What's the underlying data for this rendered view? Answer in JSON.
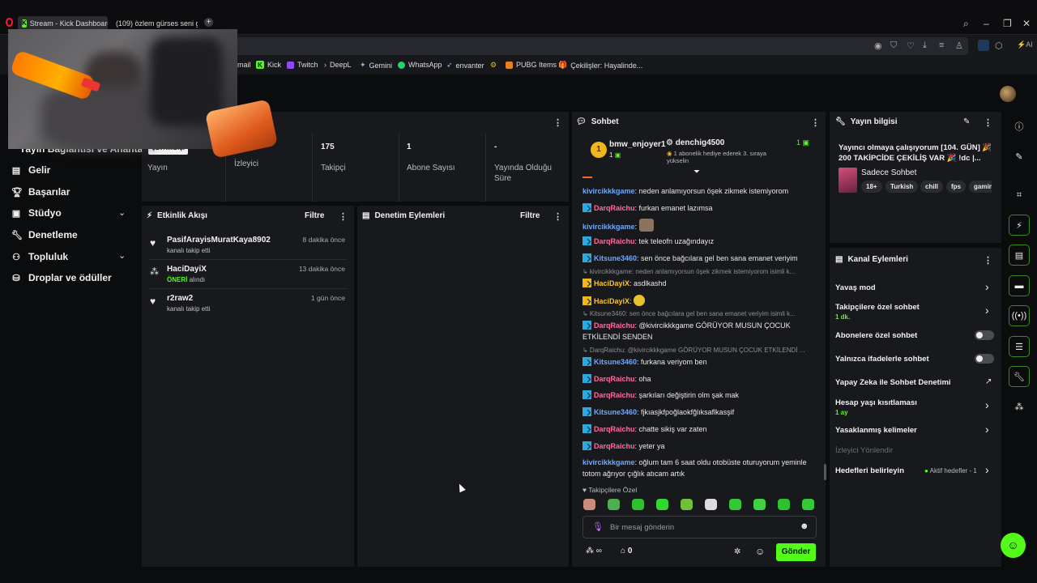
{
  "browser": {
    "tabs": [
      {
        "label": "Stream - Kick Dashboard",
        "active": true
      },
      {
        "label": "(109) özlem gürses seni g"
      }
    ],
    "bookmarks": [
      "mail",
      "Kick",
      "Twitch",
      "DeepL",
      "Gemini",
      "WhatsApp",
      "envanter",
      "PUBG Items",
      "Çekilişler: Hayalinde..."
    ]
  },
  "sidebar": {
    "partial_heading": "Yayın Bağlantısı ve Anahtarı",
    "items": [
      {
        "label": "Gelir",
        "icon": "money-icon"
      },
      {
        "label": "Başarılar",
        "icon": "trophy-icon"
      },
      {
        "label": "Stüdyo",
        "icon": "studio-icon",
        "expandable": true
      },
      {
        "label": "Denetleme",
        "icon": "wrench-icon"
      },
      {
        "label": "Topluluk",
        "icon": "community-icon",
        "expandable": true
      },
      {
        "label": "Droplar ve ödüller",
        "icon": "drops-icon"
      }
    ]
  },
  "stats": {
    "status_badge": "ÇEVRİMDIŞI",
    "stream_label": "Yayın",
    "viewers_label": "İzleyici",
    "followers_value": "175",
    "followers_label": "Takipçi",
    "subs_value": "1",
    "subs_label": "Abone Sayısı",
    "duration_value": "-",
    "duration_label": "Yayında Olduğu Süre"
  },
  "activity": {
    "title": "Etkinlik Akışı",
    "filter": "Filtre",
    "items": [
      {
        "user": "PasifArayisMuratKaya8902",
        "action": "kanalı takip etti",
        "time": "8 dakika önce",
        "icon": "heart-icon"
      },
      {
        "user": "HaciDayiX",
        "action_highlight": "ÖNERİ",
        "action": "alındı",
        "time": "13 dakika önce",
        "icon": "recommend-icon"
      },
      {
        "user": "r2raw2",
        "action": "kanalı takip etti",
        "time": "1 gün önce",
        "icon": "heart-icon"
      }
    ]
  },
  "moderation": {
    "title": "Denetim Eylemleri",
    "filter": "Filtre"
  },
  "chat": {
    "title": "Sohbet",
    "pinned": {
      "user1": "bmw_enjoyer1",
      "rank": "1",
      "count1": "1",
      "user2": "denchig4500",
      "count2": "1",
      "sub_text": "1 abonelik hediye ederek 3. sıraya yükselin"
    },
    "messages": [
      {
        "user": "kivircikkkgame",
        "color": "blue",
        "badge": false,
        "text": "neden anlamıyorsun öşek zikmek istemiyorom"
      },
      {
        "user": "DarqRaichu",
        "color": "pink",
        "badge": "blue",
        "text": "furkan emanet lazımsa"
      },
      {
        "user": "kivircikkkgame",
        "color": "blue",
        "badge": false,
        "text": "",
        "emote": "cat-emote"
      },
      {
        "user": "DarqRaichu",
        "color": "pink",
        "badge": "blue",
        "text": "tek teleofn uzağındayız"
      },
      {
        "user": "Kitsune3460",
        "color": "blue",
        "badge": "blue",
        "text": "sen önce bağcılara gel ben sana emanet veriyim"
      },
      {
        "reply": "kivircikkkgame: neden anlamıyorsun öşek zikmek istemiyorom isimli k..."
      },
      {
        "user": "HaciDayiX",
        "color": "gold",
        "badge": "gold",
        "text": "asdlkashd"
      },
      {
        "user": "HaciDayiX",
        "color": "gold",
        "badge": "gold",
        "text": "",
        "emote": "laugh-emote"
      },
      {
        "reply": "Kitsune3460: sen önce bağcılara gel ben sana emanet veriyim isimli k..."
      },
      {
        "user": "DarqRaichu",
        "color": "pink",
        "badge": "blue",
        "text": "@kivircikkkgame GÖRÜYOR MUSUN ÇOCUK ETKİLENDİ SENDEN"
      },
      {
        "reply": "DarqRaichu: @kivircikkkgame GÖRÜYOR MUSUN ÇOCUK ETKİLENDİ ..."
      },
      {
        "user": "Kitsune3460",
        "color": "blue",
        "badge": "blue",
        "text": "furkana veriyom ben"
      },
      {
        "user": "DarqRaichu",
        "color": "pink",
        "badge": "blue",
        "text": "oha"
      },
      {
        "user": "DarqRaichu",
        "color": "pink",
        "badge": "blue",
        "text": "şarkıları değiştirin olm şak mak"
      },
      {
        "user": "Kitsune3460",
        "color": "blue",
        "badge": "blue",
        "text": "fjkıasjkfpoğlaokfğlıksaflkasşif"
      },
      {
        "user": "DarqRaichu",
        "color": "pink",
        "badge": "blue",
        "text": "chatte sikiş var zaten"
      },
      {
        "user": "DarqRaichu",
        "color": "pink",
        "badge": "blue",
        "text": "yeter ya"
      },
      {
        "user": "kivircikkkgame",
        "color": "blue",
        "badge": false,
        "text": "oğlum tam 6 saat oldu otobüste oturuyorum yeminle totom ağrıyor çığlık atıcam artık"
      }
    ],
    "followers_only_label": "Takipçilere Özel",
    "input_placeholder": "Bir mesaj gönderin",
    "points_value": "∞",
    "store_value": "0",
    "send_label": "Gönder"
  },
  "stream_info": {
    "title": "Yayın bilgisi",
    "stream_title": "Yayıncı olmaya çalışıyorum [104. GÜN] 🎉 200 TAKİPCİDE ÇEKİLİŞ VAR 🎉 !dc |...",
    "category": "Sadece Sohbet",
    "tags": [
      "18+",
      "Turkish",
      "chill",
      "fps",
      "gamin"
    ]
  },
  "channel_actions": {
    "title": "Kanal Eylemleri",
    "items": [
      {
        "label": "Yavaş mod",
        "control": "arrow"
      },
      {
        "label": "Takipçilere özel sohbet",
        "sub": "1 dk.",
        "control": "arrow"
      },
      {
        "label": "Abonelere özel sohbet",
        "control": "toggle",
        "on": false
      },
      {
        "label": "Yalnızca ifadelerle sohbet",
        "control": "toggle",
        "on": false
      },
      {
        "label": "Yapay Zeka ile Sohbet Denetimi",
        "control": "external"
      },
      {
        "label": "Hesap yaşı kısıtlaması",
        "sub": "1 ay",
        "control": "arrow"
      },
      {
        "label": "Yasaklanmış kelimeler",
        "control": "arrow"
      },
      {
        "label": "İzleyici Yönlendir",
        "control": "none",
        "disabled": true
      },
      {
        "label": "Hedefleri belirleyin",
        "status": "Aktif hedefler - 1",
        "control": "arrow"
      }
    ]
  },
  "colors": {
    "accent": "#53fc18",
    "panel": "#18191c",
    "background": "#0b0c0d"
  }
}
